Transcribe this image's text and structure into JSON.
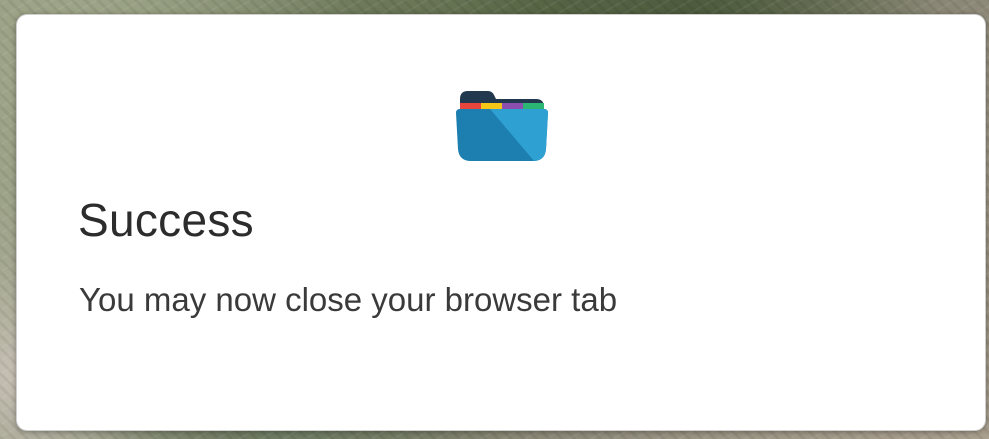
{
  "dialog": {
    "title": "Success",
    "message": "You may now close your browser tab"
  },
  "icons": {
    "logo": "folder-icon"
  },
  "colors": {
    "folder_dark": "#1d7fb0",
    "folder_light": "#2ea0d2",
    "folder_tab": "#22384e",
    "stripe_red": "#e8453c",
    "stripe_yellow": "#f5c518",
    "stripe_purple": "#8c4fb0",
    "stripe_green": "#2bb673"
  }
}
